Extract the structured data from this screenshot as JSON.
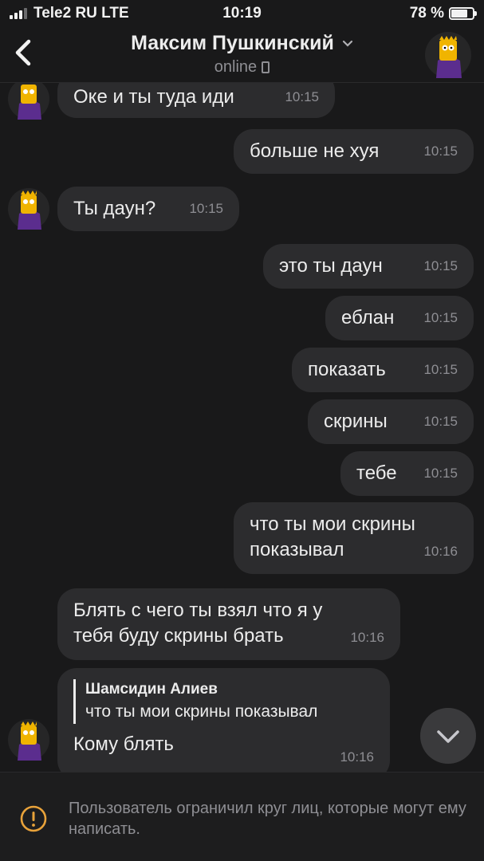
{
  "status_bar": {
    "carrier": "Tele2 RU LTE",
    "time": "10:19",
    "battery": "78 %"
  },
  "header": {
    "name": "Максим Пушкинский",
    "status": "online"
  },
  "messages": [
    {
      "side": "in",
      "text": "Оке и ты туда иди",
      "time": "10:15"
    },
    {
      "side": "out",
      "text": "больше не хуя",
      "time": "10:15"
    },
    {
      "side": "in",
      "text": "Ты даун?",
      "time": "10:15"
    },
    {
      "side": "out",
      "text": "это ты даун",
      "time": "10:15"
    },
    {
      "side": "out",
      "text": "еблан",
      "time": "10:15"
    },
    {
      "side": "out",
      "text": "показать",
      "time": "10:15"
    },
    {
      "side": "out",
      "text": "скрины",
      "time": "10:15"
    },
    {
      "side": "out",
      "text": "тебе",
      "time": "10:15"
    },
    {
      "side": "out",
      "text": "что ты мои скрины\nпоказывал",
      "time": "10:16"
    },
    {
      "side": "in",
      "text": "Блять с чего ты взял что я у\nтебя буду скрины брать",
      "time": "10:16"
    },
    {
      "side": "in",
      "text": "Кому блять",
      "time": "10:16",
      "reply": {
        "name": "Шамсидин Алиев",
        "text": "что ты мои скрины показывал"
      }
    }
  ],
  "footer": {
    "notice": "Пользователь ограничил круг лиц, которые могут ему написать."
  },
  "colors": {
    "background": "#19191a",
    "bubble": "#2c2c2e",
    "text": "#ececec",
    "muted": "#8e8e93",
    "avatar_purple": "#5b2d8e",
    "avatar_yellow": "#f0b400"
  }
}
